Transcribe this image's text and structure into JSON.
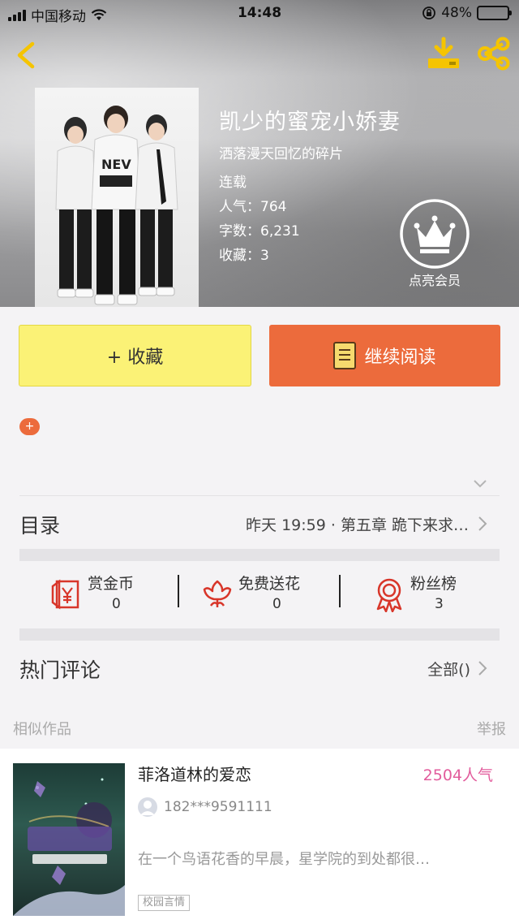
{
  "status_bar": {
    "carrier": "中国移动",
    "time": "14:48",
    "battery_percent": "48%",
    "battery_level": 0.48,
    "battery_color": "#f5c000"
  },
  "nav": {
    "back_icon": "chevron-left-icon",
    "download_icon": "download-icon",
    "share_icon": "share-icon",
    "icon_color": "#f5c400"
  },
  "book": {
    "title": "凯少的蜜宠小娇妻",
    "author": "洒落漫天回忆的碎片",
    "status": "连载",
    "popularity_label": "人气：",
    "popularity_value": "764",
    "words_label": "字数：",
    "words_value": "6,231",
    "favorites_label": "收藏：",
    "favorites_value": "3"
  },
  "vip": {
    "icon": "crown-icon",
    "label": "点亮会员"
  },
  "actions": {
    "favorite_label": "+ 收藏",
    "read_label": "继续阅读",
    "favorite_color": "#fbf276",
    "read_color": "#ec6b3c"
  },
  "add_tag_symbol": "+",
  "toc": {
    "label": "目录",
    "latest": "昨天 19:59 · 第五章 跪下来求…"
  },
  "stats": [
    {
      "icon": "red-envelope-icon",
      "label": "赏金币",
      "value": "0"
    },
    {
      "icon": "flower-icon",
      "label": "免费送花",
      "value": "0"
    },
    {
      "icon": "medal-icon",
      "label": "粉丝榜",
      "value": "3"
    }
  ],
  "comments": {
    "title": "热门评论",
    "all_label": "全部()"
  },
  "similar": {
    "label": "相似作品",
    "report_label": "举报"
  },
  "recommendation": {
    "title": "菲洛道林的爱恋",
    "popularity": "2504人气",
    "author": "182***9591111",
    "description": "在一个鸟语花香的早晨，星学院的到处都很…",
    "tag": "校园言情"
  }
}
